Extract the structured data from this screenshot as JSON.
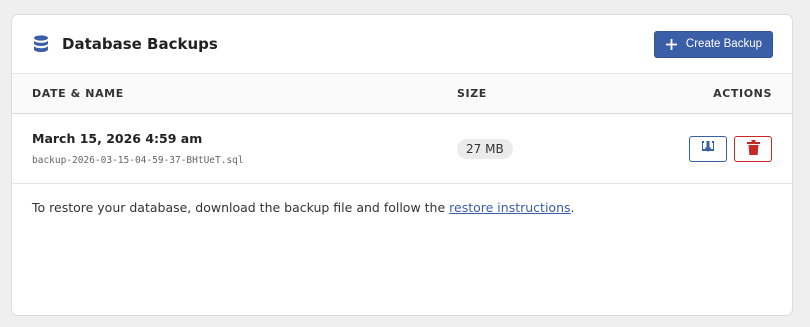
{
  "header": {
    "title": "Database Backups",
    "icon": "database-icon",
    "create_button_label": "Create Backup"
  },
  "table": {
    "columns": [
      "DATE & NAME",
      "SIZE",
      "ACTIONS"
    ],
    "rows": [
      {
        "date": "March 15, 2026 4:59 am",
        "filename": "backup-2026-03-15-04-59-37-BHtUeT.sql",
        "size": "27 MB"
      }
    ]
  },
  "footer": {
    "text_before": "To restore your database, download the backup file and follow the",
    "link_text": "restore instructions",
    "text_after": "."
  },
  "colors": {
    "primary": "#3b5ea9",
    "danger": "#c62828",
    "background": "#efefef"
  }
}
